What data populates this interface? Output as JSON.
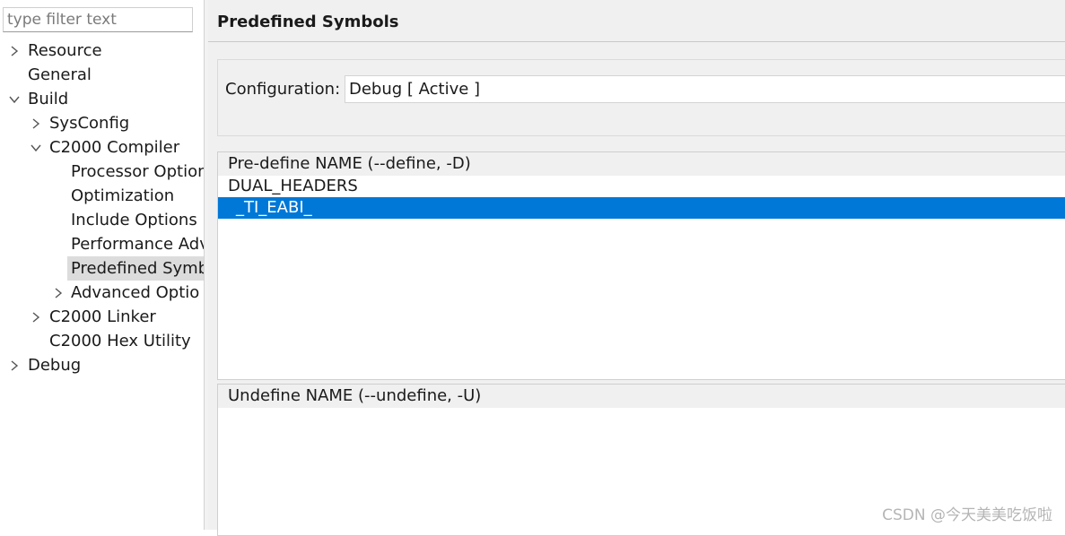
{
  "filter": {
    "placeholder": "type filter text"
  },
  "tree": [
    {
      "label": "Resource",
      "level": 0,
      "chevron": "right"
    },
    {
      "label": "General",
      "level": 0,
      "chevron": ""
    },
    {
      "label": "Build",
      "level": 0,
      "chevron": "down"
    },
    {
      "label": "SysConfig",
      "level": 1,
      "chevron": "right"
    },
    {
      "label": "C2000 Compiler",
      "level": 1,
      "chevron": "down"
    },
    {
      "label": "Processor Option",
      "level": 2,
      "chevron": ""
    },
    {
      "label": "Optimization",
      "level": 2,
      "chevron": ""
    },
    {
      "label": "Include Options",
      "level": 2,
      "chevron": ""
    },
    {
      "label": "Performance Adv",
      "level": 2,
      "chevron": ""
    },
    {
      "label": "Predefined Symb",
      "level": 2,
      "chevron": "",
      "selected": true
    },
    {
      "label": "Advanced Optio",
      "level": 2,
      "chevron": "right"
    },
    {
      "label": "C2000 Linker",
      "level": 1,
      "chevron": "right"
    },
    {
      "label": "C2000 Hex Utility",
      "level": 1,
      "chevron": ""
    },
    {
      "label": "Debug",
      "level": 0,
      "chevron": "right"
    }
  ],
  "page": {
    "title": "Predefined Symbols"
  },
  "configuration": {
    "label": "Configuration:",
    "value": "Debug  [ Active ]"
  },
  "predefine": {
    "header": "Pre-define NAME (--define, -D)",
    "items": [
      "DUAL_HEADERS",
      "_TI_EABI_"
    ],
    "selected_index": 1
  },
  "undefine": {
    "header": "Undefine NAME (--undefine, -U)",
    "items": []
  },
  "watermark": "CSDN @今天美美吃饭啦",
  "colors": {
    "selection": "#0078d7",
    "tree_selection": "#dcdcdc"
  }
}
